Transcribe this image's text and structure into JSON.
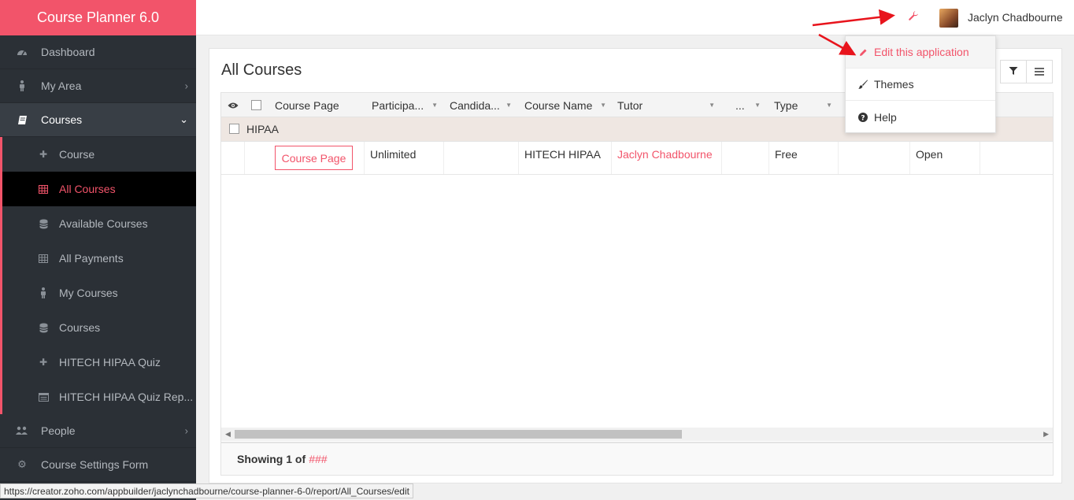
{
  "app": {
    "title": "Course Planner 6.0"
  },
  "sidebar": {
    "items": [
      {
        "label": "Dashboard",
        "icon": "dashboard-icon"
      },
      {
        "label": "My Area",
        "icon": "person-icon"
      },
      {
        "label": "Courses",
        "icon": "book-icon"
      }
    ],
    "sub_items": [
      {
        "label": "Course",
        "icon": "plus-icon"
      },
      {
        "label": "All Courses",
        "icon": "table-icon"
      },
      {
        "label": "Available Courses",
        "icon": "database-icon"
      },
      {
        "label": "All Payments",
        "icon": "table-icon"
      },
      {
        "label": "My Courses",
        "icon": "person-icon"
      },
      {
        "label": "Courses",
        "icon": "database-icon"
      },
      {
        "label": "HITECH HIPAA Quiz",
        "icon": "plus-icon"
      },
      {
        "label": "HITECH HIPAA Quiz Rep...",
        "icon": "report-icon"
      }
    ],
    "bottom_items": [
      {
        "label": "People",
        "icon": "users-icon"
      },
      {
        "label": "Course Settings Form",
        "icon": "gear-icon"
      }
    ]
  },
  "topbar": {
    "username": "Jaclyn Chadbourne"
  },
  "report": {
    "title": "All Courses",
    "columns": [
      "Course Page",
      "Participa...",
      "Candida...",
      "Course Name",
      "Tutor",
      "...",
      "Type"
    ],
    "group": "HIPAA",
    "row": {
      "course_page_button": "Course Page",
      "participants": "Unlimited",
      "course_name": "HITECH HIPAA",
      "tutor": "Jaclyn Chadbourne",
      "type": "Free",
      "status": "Open"
    },
    "footer_label": "Showing 1 of",
    "footer_count": "###"
  },
  "menu": {
    "items": [
      {
        "label": "Edit this application",
        "icon": "pencil-icon"
      },
      {
        "label": "Themes",
        "icon": "brush-icon"
      },
      {
        "label": "Help",
        "icon": "question-icon"
      }
    ]
  },
  "statusbar": {
    "url": "https://creator.zoho.com/appbuilder/jaclynchadbourne/course-planner-6-0/report/All_Courses/edit"
  },
  "colors": {
    "accent": "#f2546a",
    "sidebar": "#2b3036",
    "annotation": "#e8141c"
  }
}
